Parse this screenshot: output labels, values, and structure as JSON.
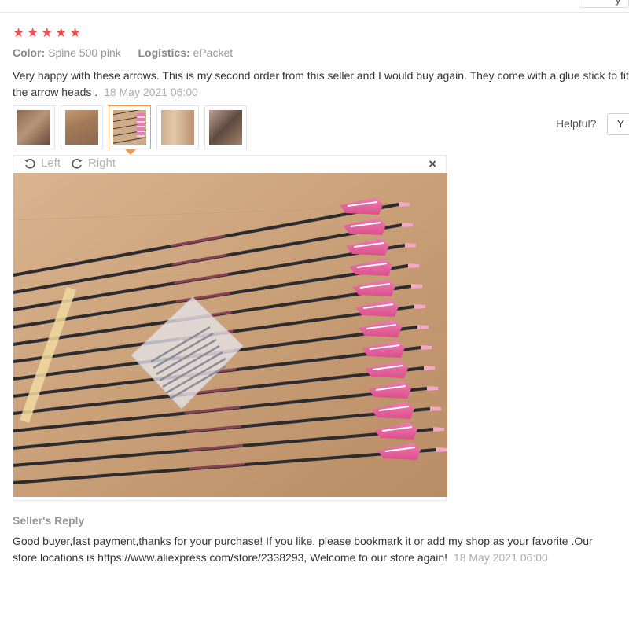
{
  "rating": {
    "stars": 5,
    "star_color": "#f14e4e"
  },
  "attributes": [
    {
      "key": "Color:",
      "value": "Spine 500 pink"
    },
    {
      "key": "Logistics:",
      "value": "ePacket"
    }
  ],
  "review": {
    "text": "Very happy with these arrows. This is my second order from this seller and I would buy again. They come with a glue stick to fit the arrow heads .",
    "date": "18 May 2021 06:00"
  },
  "thumbnails": [
    {
      "alt": "review photo 1"
    },
    {
      "alt": "review photo 2"
    },
    {
      "alt": "review photo 3",
      "active": true
    },
    {
      "alt": "review photo 4"
    },
    {
      "alt": "review photo 5"
    }
  ],
  "helpful": {
    "label": "Helpful?",
    "button": "Y"
  },
  "viewer": {
    "rotate_left": "Left",
    "rotate_right": "Right",
    "close": "×"
  },
  "seller_reply": {
    "title": "Seller's Reply",
    "text": "Good buyer,fast payment,thanks for your purchase! If you like, please bookmark it or add my shop as your favorite .Our store locations is https://www.aliexpress.com/store/2338293, Welcome to our store again!",
    "date": "18 May 2021 06:00"
  },
  "top_bar": {
    "dropdown_text": "y"
  },
  "colors": {
    "accent": "#f29a4a",
    "muted": "#999999",
    "arrow_fletch": "#e8609a"
  }
}
